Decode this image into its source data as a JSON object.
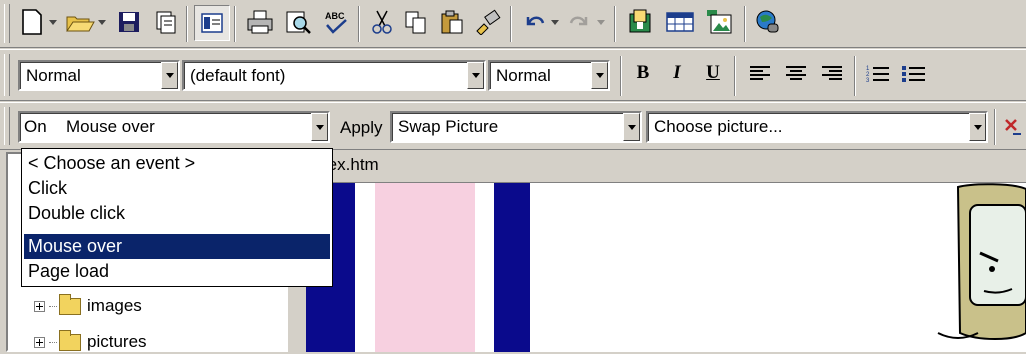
{
  "toolbar_standard": {
    "buttons": [
      "new-icon",
      "open-icon",
      "save-icon",
      "publish-icon",
      "folder-list-icon",
      "print-icon",
      "print-preview-icon",
      "spelling-icon",
      "cut-icon",
      "copy-icon",
      "paste-icon",
      "format-painter-icon",
      "undo-icon",
      "redo-icon",
      "insert-component-icon",
      "insert-table-icon",
      "insert-picture-icon",
      "hyperlink-icon"
    ]
  },
  "toolbar_formatting": {
    "style": "Normal",
    "font": "(default font)",
    "size": "Normal",
    "bold_label": "B",
    "italic_label": "I",
    "underline_label": "U"
  },
  "toolbar_dhtml": {
    "on_label": "On",
    "event_value": "Mouse over",
    "apply_label": "Apply",
    "effect_value": "Swap Picture",
    "settings_value": "Choose picture...",
    "remove_effect": "remove-effect-icon"
  },
  "event_dropdown": {
    "items": [
      "< Choose an event >",
      "Click",
      "Double click",
      "Mouse over",
      "Page load"
    ],
    "selected_index": 3
  },
  "editor": {
    "tab_title": "index.htm"
  },
  "folder_list": {
    "items": [
      "images",
      "pictures"
    ]
  },
  "colors": {
    "navy": "#0a0a8c",
    "pink": "#f7d0e0",
    "selection": "#0a246a"
  }
}
